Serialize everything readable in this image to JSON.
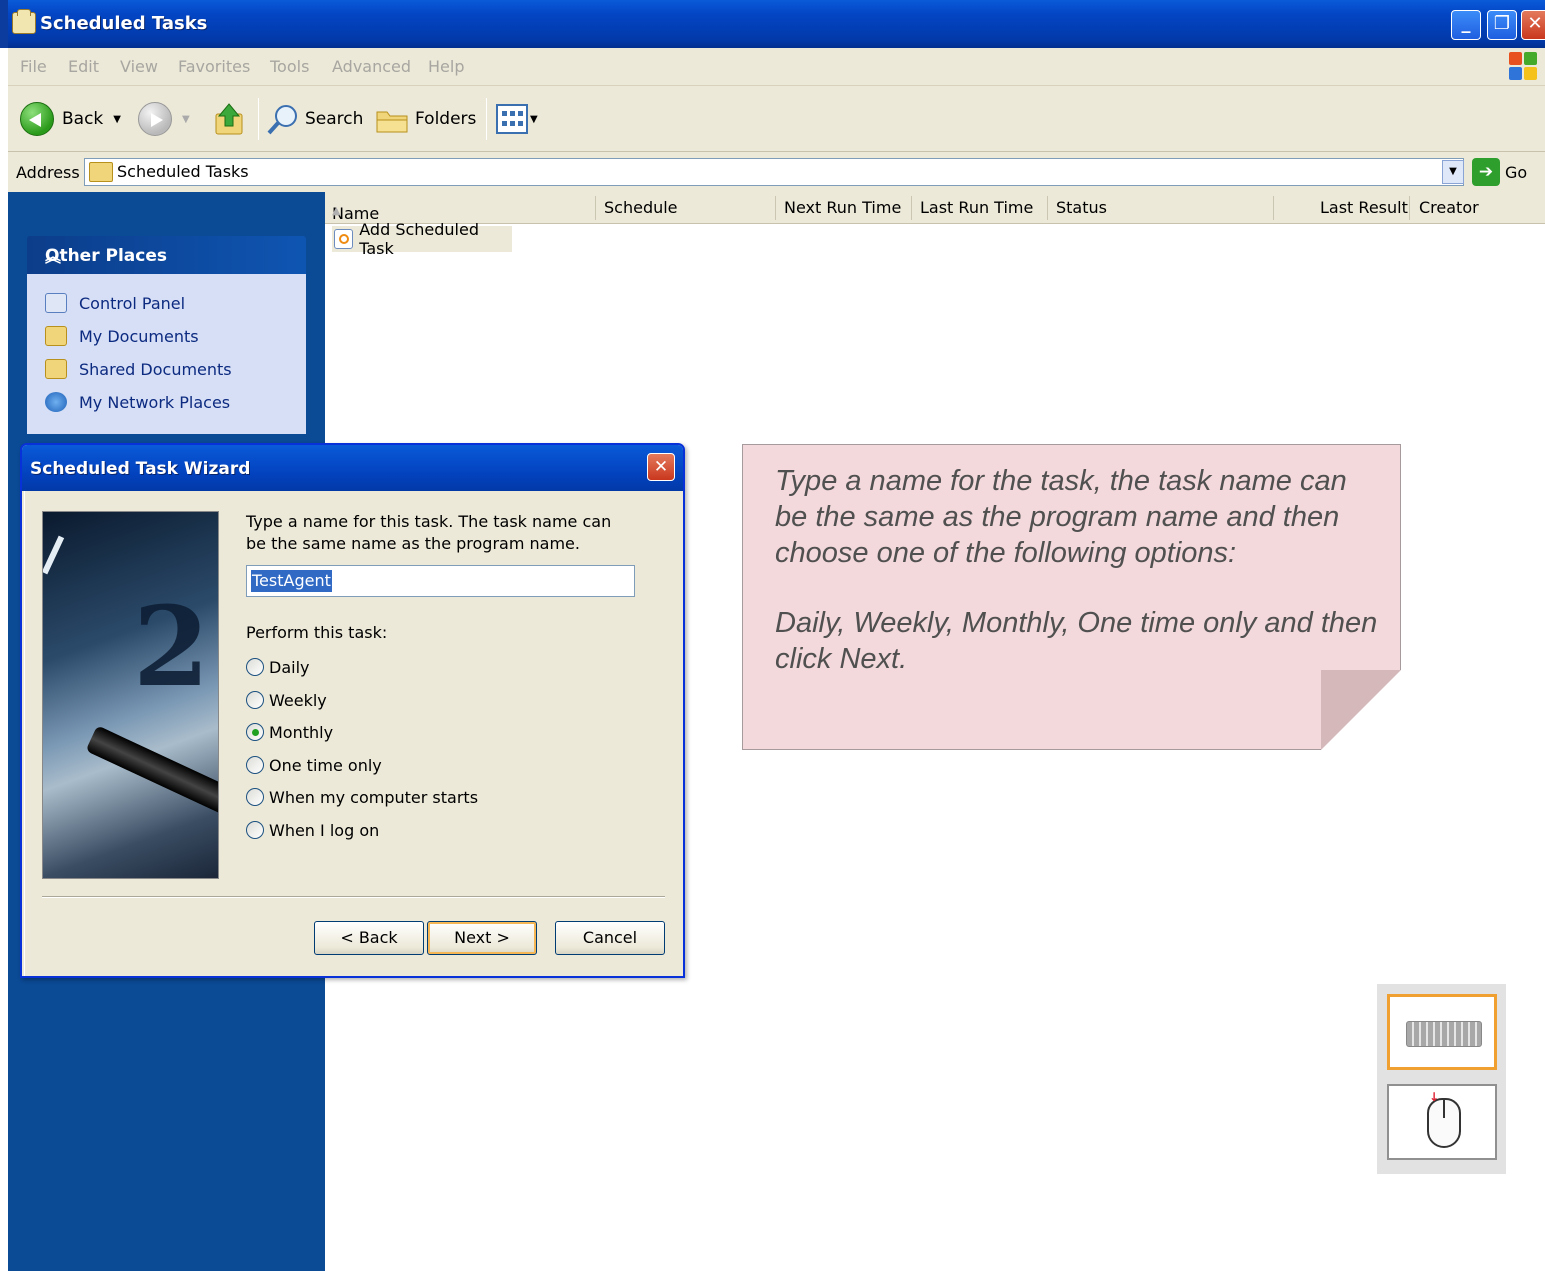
{
  "window": {
    "title": "Scheduled Tasks"
  },
  "menu": {
    "items": [
      "File",
      "Edit",
      "View",
      "Favorites",
      "Tools",
      "Advanced",
      "Help"
    ]
  },
  "toolbar": {
    "back_label": "Back",
    "search_label": "Search",
    "folders_label": "Folders"
  },
  "address": {
    "label": "Address",
    "value": "Scheduled Tasks",
    "go_label": "Go"
  },
  "other_places": {
    "header": "Other Places",
    "items": [
      "Control Panel",
      "My Documents",
      "Shared Documents",
      "My Network Places"
    ]
  },
  "columns": [
    "Name",
    "Schedule",
    "Next Run Time",
    "Last Run Time",
    "Status",
    "Last Result",
    "Creator"
  ],
  "files": [
    {
      "name": "Add Scheduled Task"
    }
  ],
  "wizard": {
    "title": "Scheduled Task Wizard",
    "prompt": "Type a name for this task.  The task name can be the same name as the program name.",
    "task_name": "TestAgent",
    "perform_label": "Perform this task:",
    "options": [
      "Daily",
      "Weekly",
      "Monthly",
      "One time only",
      "When my computer starts",
      "When I log on"
    ],
    "selected_option": "Monthly",
    "back_button": "< Back",
    "next_button": "Next >",
    "cancel_button": "Cancel"
  },
  "callout": {
    "paragraph1": "Type a name for the task, the task name can be the same as the program name and then choose one of the following options:",
    "paragraph2": "Daily, Weekly, Monthly, One time only and then click Next."
  },
  "colors": {
    "xp_blue": "#0345c4",
    "sidebar_blue": "#0b4a95",
    "callout_pink": "#f3d9db",
    "selection": "#316ac5"
  }
}
